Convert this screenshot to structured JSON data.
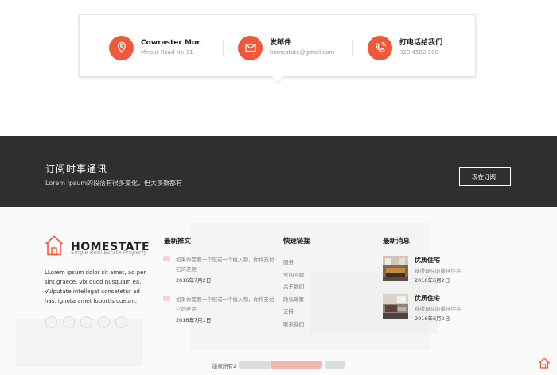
{
  "contact": {
    "items": [
      {
        "icon": "location-pin-icon",
        "title": "Cowraster Mor",
        "detail": "Mirpur Road No-11"
      },
      {
        "icon": "envelope-icon",
        "title": "发邮件",
        "detail": "homestate@gmail.com"
      },
      {
        "icon": "phone-icon",
        "title": "打电话给我们",
        "detail": "320 4582 100"
      }
    ],
    "accent_color": "#f0583a"
  },
  "newsletter": {
    "title": "订阅时事通讯",
    "subtitle": "Lorem Ipsum的段落有很多变化，但大多数都有",
    "button_label": "现在订阅!"
  },
  "footer": {
    "brand": {
      "name": "HOMESTATE",
      "tagline": "Single Real Estate Property",
      "about": "LLorem ipsum dolor sit amet, ad per sint graece, vix quod nusquam ea, Vulputate intellegat consetetur ad has, ignota amet lobortis cueum.",
      "logo_icon": "house-outline-icon"
    },
    "recent_posts": {
      "title": "最新推文",
      "items": [
        {
          "text": "如果你需要一个冠或一个植入物，你将支付它的差距",
          "date": "2016年7月2日"
        },
        {
          "text": "如果你需要一个冠或一个植入物，你将支付它的差距",
          "date": "2016年7月1日"
        }
      ]
    },
    "quick_links": {
      "title": "快速链接",
      "items": [
        "服务",
        "常问问题",
        "关于我们",
        "隐私政策",
        "支持",
        "联系我们"
      ]
    },
    "latest_news": {
      "title": "最新消息",
      "items": [
        {
          "title": "优质住宅",
          "desc": "获得现在的最佳住宅",
          "date": "2016年6月2日"
        },
        {
          "title": "优质住宅",
          "desc": "获得现在的最佳住宅",
          "date": "2016年6月2日"
        }
      ]
    },
    "copyright_prefix": "版权所有2"
  }
}
